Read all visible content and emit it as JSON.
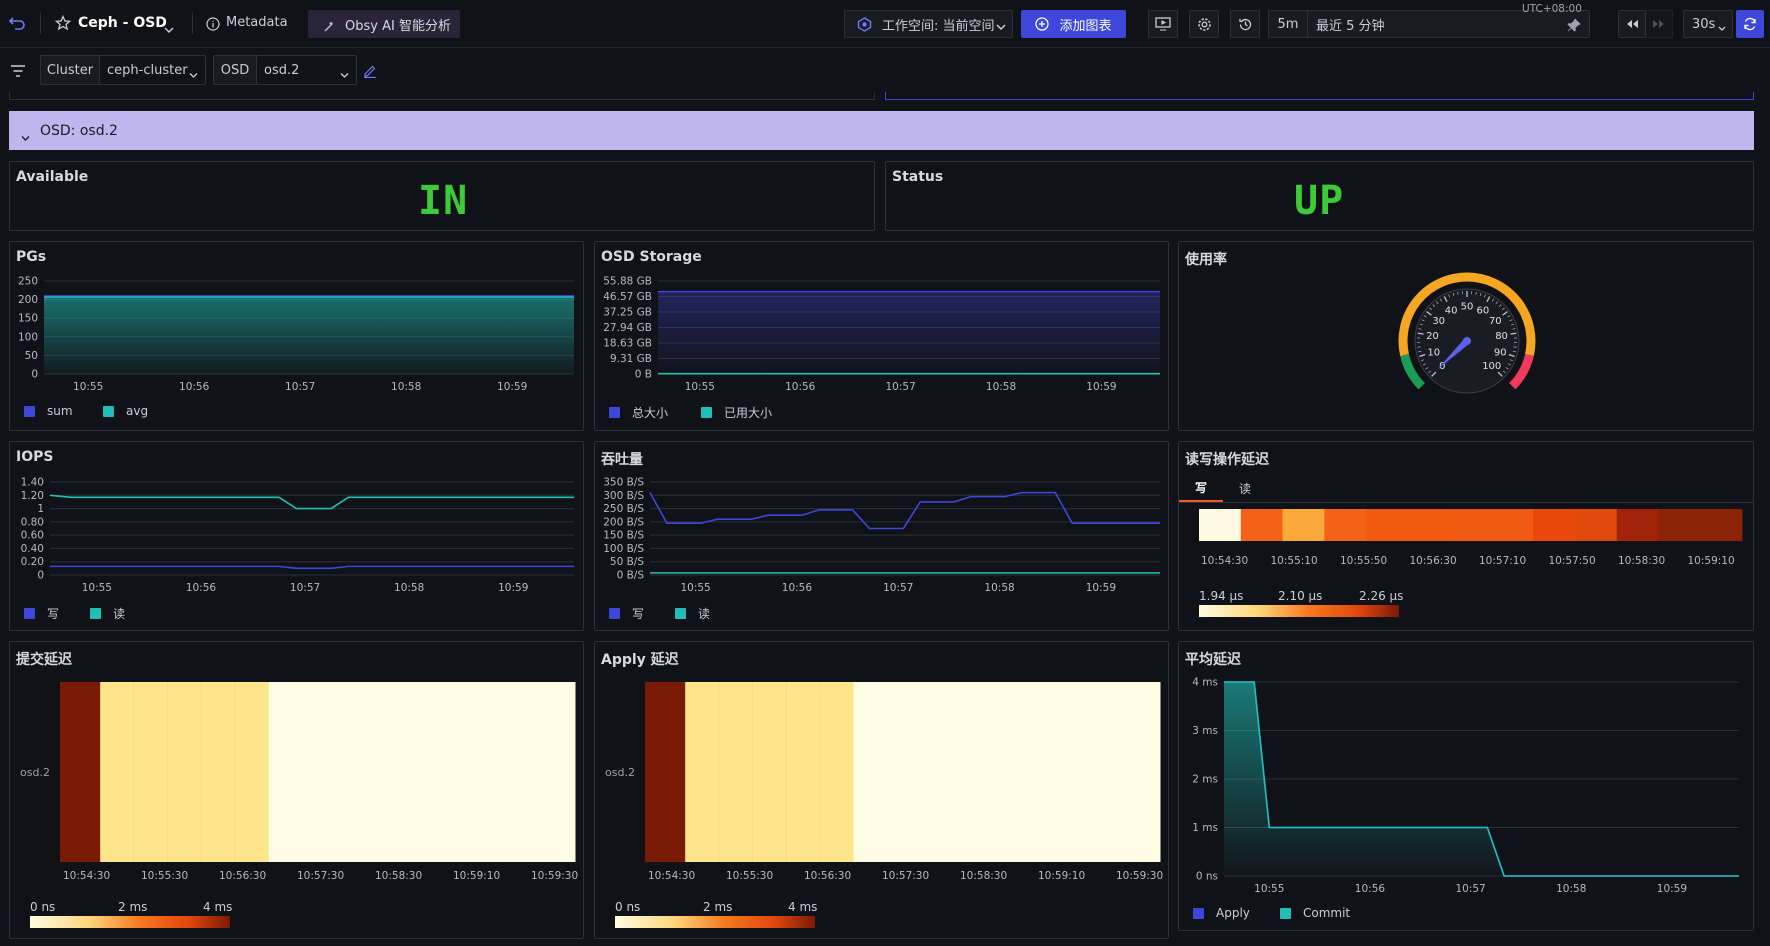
{
  "topbar": {
    "title": "Ceph - OSD",
    "metadata_label": "Metadata",
    "ai_label": "Obsy AI 智能分析",
    "workspace_label": "工作空间: 当前空间",
    "add_chart_label": "添加图表",
    "range_short": "5m",
    "range_long": "最近 5 分钟",
    "timezone": "UTC+08:00",
    "refresh_interval": "30s"
  },
  "filters": {
    "cluster_label": "Cluster",
    "cluster_value": "ceph-cluster",
    "osd_label": "OSD",
    "osd_value": "osd.2"
  },
  "row": {
    "title": "OSD: osd.2"
  },
  "stats": {
    "available": {
      "title": "Available",
      "value": "IN"
    },
    "status": {
      "title": "Status",
      "value": "UP"
    }
  },
  "time_ticks": [
    "10:55",
    "10:56",
    "10:57",
    "10:58",
    "10:59"
  ],
  "heat_ticks": [
    "10:54:30",
    "10:55:30",
    "10:56:30",
    "10:57:30",
    "10:58:30",
    "10:59:10",
    "10:59:30"
  ],
  "latency_heat_ticks": [
    "10:54:30",
    "10:55:10",
    "10:55:50",
    "10:56:30",
    "10:57:10",
    "10:57:50",
    "10:58:30",
    "10:59:10"
  ],
  "colors": {
    "blue": "#3d47d9",
    "teal": "#1fbfb8",
    "stat_green": "#3ec939",
    "row_bg": "#c0b6ee"
  },
  "panels": {
    "pgs": {
      "title": "PGs",
      "legend": [
        "sum",
        "avg"
      ]
    },
    "osd_storage": {
      "title": "OSD Storage",
      "legend": [
        "总大小",
        "已用大小"
      ]
    },
    "usage": {
      "title": "使用率"
    },
    "iops": {
      "title": "IOPS",
      "legend": [
        "写",
        "读"
      ]
    },
    "throughput": {
      "title": "吞吐量",
      "legend": [
        "写",
        "读"
      ]
    },
    "rw_latency": {
      "title": "读写操作延迟",
      "tabs": [
        "写",
        "读"
      ],
      "scale_labels": [
        "1.94 µs",
        "2.10 µs",
        "2.26 µs"
      ]
    },
    "commit_latency": {
      "title": "提交延迟",
      "row_label": "osd.2",
      "scale_labels": [
        "0 ns",
        "2 ms",
        "4 ms"
      ]
    },
    "apply_latency": {
      "title": "Apply 延迟",
      "row_label": "osd.2",
      "scale_labels": [
        "0 ns",
        "2 ms",
        "4 ms"
      ]
    },
    "avg_latency": {
      "title": "平均延迟",
      "legend": [
        "Apply",
        "Commit"
      ]
    }
  },
  "chart_data": [
    {
      "panel": "pgs",
      "type": "area",
      "x": [
        "10:54:35",
        "10:59:35"
      ],
      "yticks": [
        "0",
        "50",
        "100",
        "150",
        "200",
        "250"
      ],
      "ylim": [
        0,
        250
      ],
      "series": [
        {
          "name": "sum",
          "values": [
            210,
            210
          ]
        },
        {
          "name": "avg",
          "values": [
            207,
            207
          ]
        }
      ]
    },
    {
      "panel": "osd_storage",
      "type": "line",
      "x": [
        "10:54:35",
        "10:59:35"
      ],
      "yticks": [
        "0 B",
        "9.31 GB",
        "18.63 GB",
        "27.94 GB",
        "37.25 GB",
        "46.57 GB",
        "55.88 GB"
      ],
      "ylim": [
        0,
        55.88
      ],
      "series": [
        {
          "name": "总大小",
          "values": [
            49.5,
            49.5
          ]
        },
        {
          "name": "已用大小",
          "values": [
            0.2,
            0.2
          ]
        }
      ]
    },
    {
      "panel": "usage",
      "type": "gauge",
      "value": 0.4,
      "min": 0,
      "max": 100,
      "ticks": [
        "0",
        "10",
        "20",
        "30",
        "40",
        "50",
        "60",
        "70",
        "80",
        "90",
        "100"
      ]
    },
    {
      "panel": "iops",
      "type": "line",
      "yticks": [
        "0",
        "0.20",
        "0.40",
        "0.60",
        "0.80",
        "1",
        "1.20",
        "1.40"
      ],
      "ylim": [
        0,
        1.4
      ],
      "x": [
        "10:54:33",
        "10:54:45",
        "10:56:45",
        "10:56:55",
        "10:57:15",
        "10:57:25",
        "10:59:35"
      ],
      "series": [
        {
          "name": "写",
          "values": [
            0.13,
            0.13,
            0.13,
            0.1,
            0.1,
            0.13,
            0.13
          ]
        },
        {
          "name": "读",
          "values": [
            1.2,
            1.17,
            1.17,
            1.0,
            1.0,
            1.17,
            1.17
          ]
        }
      ]
    },
    {
      "panel": "throughput",
      "type": "line",
      "yticks": [
        "0 B/S",
        "50 B/S",
        "100 B/S",
        "150 B/S",
        "200 B/S",
        "250 B/S",
        "300 B/S",
        "350 B/S"
      ],
      "ylim": [
        0,
        350
      ],
      "x": [
        "10:54:33",
        "10:54:43",
        "10:55:03",
        "10:55:13",
        "10:55:33",
        "10:55:43",
        "10:56:03",
        "10:56:13",
        "10:56:33",
        "10:56:43",
        "10:57:03",
        "10:57:13",
        "10:57:33",
        "10:57:43",
        "10:58:03",
        "10:58:13",
        "10:58:33",
        "10:58:43",
        "10:59:35"
      ],
      "series": [
        {
          "name": "写",
          "values": [
            310,
            195,
            195,
            210,
            210,
            225,
            225,
            245,
            245,
            175,
            175,
            275,
            275,
            295,
            295,
            310,
            310,
            195,
            195
          ]
        },
        {
          "name": "读",
          "values": [
            8,
            8,
            8,
            8,
            8,
            8,
            8,
            8,
            8,
            8,
            8,
            8,
            8,
            8,
            8,
            8,
            8,
            8,
            8
          ]
        }
      ]
    },
    {
      "panel": "avg_latency",
      "type": "line",
      "yticks": [
        "0 ns",
        "1 ms",
        "2 ms",
        "3 ms",
        "4 ms"
      ],
      "ylim": [
        0,
        4
      ],
      "x": [
        "10:54:33",
        "10:54:51",
        "10:55:00",
        "10:57:10",
        "10:57:20",
        "10:59:40"
      ],
      "series": [
        {
          "name": "Apply",
          "values": [
            4,
            4,
            1,
            1,
            0,
            0
          ]
        },
        {
          "name": "Commit",
          "values": [
            4,
            4,
            1,
            1,
            0,
            0
          ]
        }
      ]
    }
  ]
}
